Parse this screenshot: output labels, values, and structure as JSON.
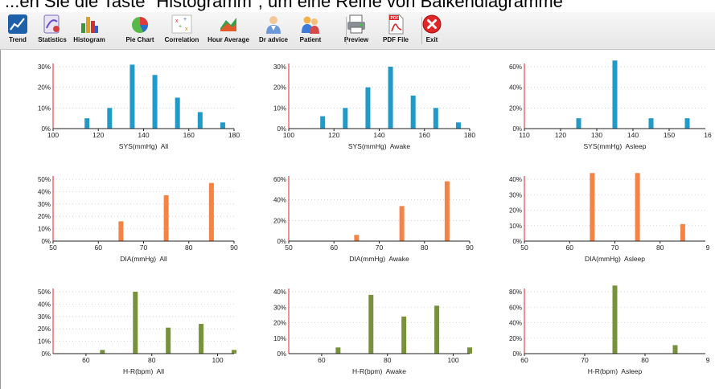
{
  "document": {
    "text": "...en Sie die Taste \"Histogramm\", um eine Reihe von Balkendiagramme"
  },
  "toolbar": {
    "buttons": [
      {
        "name": "trend",
        "label": "Trend",
        "icon": "trend-chart-icon"
      },
      {
        "name": "statistics",
        "label": "Statistics",
        "icon": "statistics-icon"
      },
      {
        "name": "histogram",
        "label": "Histogram",
        "icon": "histogram-icon"
      },
      {
        "name": "pie-chart",
        "label": "Pie Chart",
        "icon": "pie-chart-icon"
      },
      {
        "name": "correlation",
        "label": "Correlation",
        "icon": "correlation-icon"
      },
      {
        "name": "hour-average",
        "label": "Hour Average",
        "icon": "hour-average-icon"
      },
      {
        "name": "dr-advice",
        "label": "Dr advice",
        "icon": "doctor-icon"
      },
      {
        "name": "patient",
        "label": "Patient",
        "icon": "patient-icon"
      },
      {
        "name": "preview",
        "label": "Preview",
        "icon": "printer-icon"
      },
      {
        "name": "pdf-file",
        "label": "PDF File",
        "icon": "pdf-icon"
      },
      {
        "name": "exit",
        "label": "Exit",
        "icon": "exit-icon"
      }
    ]
  },
  "colors": {
    "sys": "#1f9ac9",
    "dia": "#f58346",
    "hr": "#78923c",
    "axis_left": "#e02020"
  },
  "chart_data": [
    {
      "type": "bar",
      "xlabel": "SYS(mmHg)  All",
      "xlim": [
        100,
        180
      ],
      "xticks": [
        100,
        120,
        140,
        160,
        180
      ],
      "yticks": [
        "0%",
        "10%",
        "20%",
        "30%"
      ],
      "ymax": 30,
      "x": [
        115,
        125,
        135,
        145,
        155,
        165,
        175
      ],
      "values": [
        5,
        10,
        31,
        26,
        15,
        8,
        3
      ],
      "color": "sys"
    },
    {
      "type": "bar",
      "xlabel": "SYS(mmHg)  Awake",
      "xlim": [
        100,
        180
      ],
      "xticks": [
        100,
        120,
        140,
        160,
        180
      ],
      "yticks": [
        "0%",
        "10%",
        "20%",
        "30%"
      ],
      "ymax": 30,
      "x": [
        115,
        125,
        135,
        145,
        155,
        165,
        175
      ],
      "values": [
        6,
        10,
        20,
        30,
        16,
        10,
        3
      ],
      "color": "sys"
    },
    {
      "type": "bar",
      "xlabel": "SYS(mmHg)  Asleep",
      "xlim": [
        110,
        160
      ],
      "xticks": [
        110,
        120,
        130,
        140,
        150,
        "16"
      ],
      "yticks": [
        "0%",
        "20%",
        "40%",
        "60%"
      ],
      "ymax": 60,
      "x": [
        125,
        135,
        145,
        155
      ],
      "values": [
        10,
        66,
        10,
        10
      ],
      "color": "sys"
    },
    {
      "type": "bar",
      "xlabel": "DIA(mmHg)  All",
      "xlim": [
        50,
        90
      ],
      "xticks": [
        50,
        60,
        70,
        80,
        90
      ],
      "yticks": [
        "0%",
        "10%",
        "20%",
        "30%",
        "40%",
        "50%"
      ],
      "ymax": 50,
      "x": [
        65,
        75,
        85
      ],
      "values": [
        16,
        37,
        47
      ],
      "color": "dia"
    },
    {
      "type": "bar",
      "xlabel": "DIA(mmHg)  Awake",
      "xlim": [
        50,
        90
      ],
      "xticks": [
        50,
        60,
        70,
        80,
        90
      ],
      "yticks": [
        "0%",
        "20%",
        "40%",
        "60%"
      ],
      "ymax": 60,
      "x": [
        65,
        75,
        85
      ],
      "values": [
        6,
        34,
        58
      ],
      "color": "dia"
    },
    {
      "type": "bar",
      "xlabel": "DIA(mmHg)  Asleep",
      "xlim": [
        50,
        90
      ],
      "xticks": [
        50,
        60,
        70,
        80,
        "9"
      ],
      "yticks": [
        "0%",
        "10%",
        "20%",
        "30%",
        "40%"
      ],
      "ymax": 40,
      "x": [
        65,
        75,
        85
      ],
      "values": [
        44,
        44,
        11
      ],
      "color": "dia"
    },
    {
      "type": "bar",
      "xlabel": "H-R(bpm)  All",
      "xlim": [
        50,
        105
      ],
      "xticks": [
        60,
        80,
        100
      ],
      "yticks": [
        "0%",
        "10%",
        "20%",
        "30%",
        "40%",
        "50%"
      ],
      "ymax": 50,
      "x": [
        65,
        75,
        85,
        95,
        105
      ],
      "values": [
        3,
        50,
        21,
        24,
        3
      ],
      "color": "hr"
    },
    {
      "type": "bar",
      "xlabel": "H-R(bpm)  Awake",
      "xlim": [
        50,
        105
      ],
      "xticks": [
        60,
        80,
        100
      ],
      "yticks": [
        "0%",
        "10%",
        "20%",
        "30%",
        "40%"
      ],
      "ymax": 40,
      "x": [
        65,
        75,
        85,
        95,
        105
      ],
      "values": [
        4,
        38,
        24,
        31,
        4
      ],
      "color": "hr"
    },
    {
      "type": "bar",
      "xlabel": "H-R(bpm)  Asleep",
      "xlim": [
        60,
        90
      ],
      "xticks": [
        60,
        70,
        80,
        "9"
      ],
      "yticks": [
        "0%",
        "20%",
        "40%",
        "60%",
        "80%"
      ],
      "ymax": 80,
      "x": [
        75,
        85
      ],
      "values": [
        88,
        11
      ],
      "color": "hr"
    }
  ]
}
